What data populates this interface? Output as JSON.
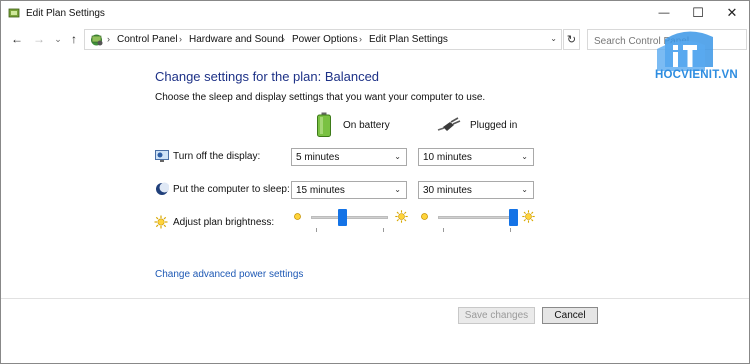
{
  "window": {
    "title": "Edit Plan Settings",
    "minimize_glyph": "—",
    "maximize_glyph": "☐",
    "close_glyph": "✕"
  },
  "nav": {
    "back_glyph": "←",
    "forward_glyph": "→",
    "recent_glyph": "⌄",
    "up_glyph": "↑",
    "refresh_glyph": "↻",
    "breadcrumb": [
      "Control Panel",
      "Hardware and Sound",
      "Power Options",
      "Edit Plan Settings"
    ],
    "breadcrumb_separator": "›",
    "search_placeholder": "Search Control Panel"
  },
  "watermark": {
    "logo_text": "HOCVIENIT.VN",
    "logo_letters": "iT",
    "brand_color": "#2e8de0"
  },
  "content": {
    "heading": "Change settings for the plan: Balanced",
    "subtext": "Choose the sleep and display settings that you want your computer to use.",
    "columns": {
      "battery": "On battery",
      "plugged": "Plugged in"
    },
    "rows": {
      "display": {
        "label": "Turn off the display:",
        "battery_value": "5 minutes",
        "plugged_value": "10 minutes"
      },
      "sleep": {
        "label": "Put the computer to sleep:",
        "battery_value": "15 minutes",
        "plugged_value": "30 minutes"
      },
      "brightness": {
        "label": "Adjust plan brightness:",
        "battery_level": 0.4,
        "plugged_level": 1.0
      }
    },
    "advanced_link": "Change advanced power settings"
  },
  "footer": {
    "save_label": "Save changes",
    "cancel_label": "Cancel"
  },
  "colors": {
    "heading": "#1e3287",
    "link": "#1e59b5",
    "slider_thumb": "#1473e6"
  },
  "icons": [
    "app-power-icon",
    "battery-icon",
    "plug-icon",
    "display-icon",
    "moon-icon",
    "brightness-icon",
    "sun-small-icon",
    "sun-large-icon"
  ]
}
